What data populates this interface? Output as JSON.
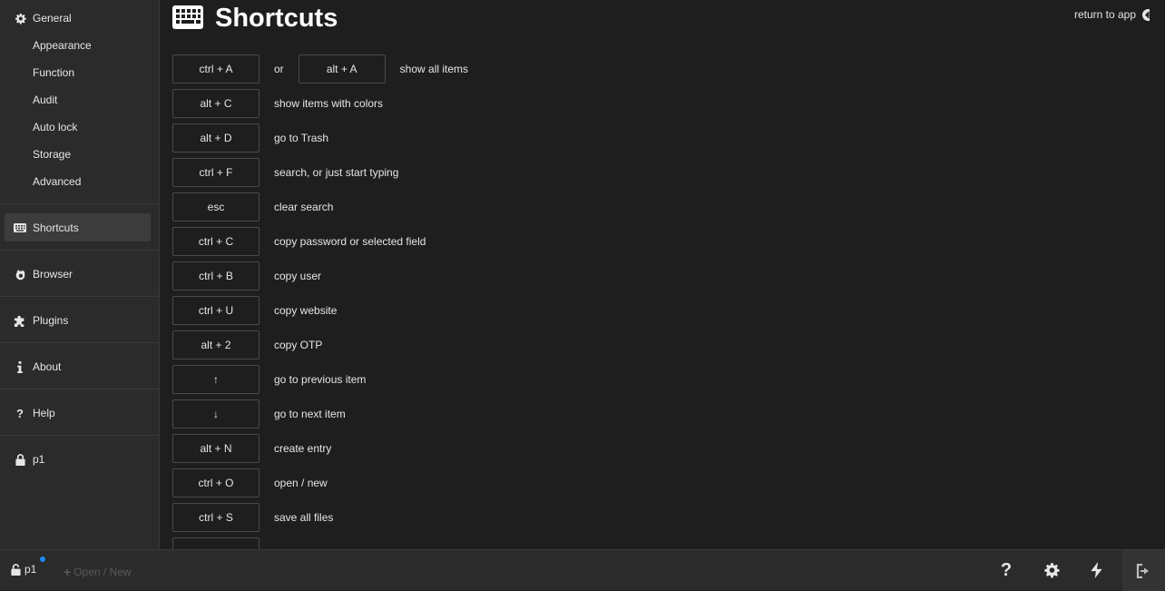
{
  "sidebar": {
    "general": "General",
    "sub_items": [
      "Appearance",
      "Function",
      "Audit",
      "Auto lock",
      "Storage",
      "Advanced"
    ],
    "shortcuts": "Shortcuts",
    "browser": "Browser",
    "plugins": "Plugins",
    "about": "About",
    "help": "Help",
    "file": "p1"
  },
  "header": {
    "title": "Shortcuts",
    "return_label": "return to app"
  },
  "shortcuts": {
    "or_label": "or",
    "rows": [
      {
        "key": "ctrl + A",
        "alt_key": "alt + A",
        "desc": "show all items"
      },
      {
        "key": "alt + C",
        "desc": "show items with colors"
      },
      {
        "key": "alt + D",
        "desc": "go to Trash"
      },
      {
        "key": "ctrl + F",
        "desc": "search, or just start typing"
      },
      {
        "key": "esc",
        "desc": "clear search"
      },
      {
        "key": "ctrl + C",
        "desc": "copy password or selected field"
      },
      {
        "key": "ctrl + B",
        "desc": "copy user"
      },
      {
        "key": "ctrl + U",
        "desc": "copy website"
      },
      {
        "key": "alt + 2",
        "desc": "copy OTP"
      },
      {
        "key": "↑",
        "desc": "go to previous item"
      },
      {
        "key": "↓",
        "desc": "go to next item"
      },
      {
        "key": "alt + N",
        "desc": "create entry"
      },
      {
        "key": "ctrl + O",
        "desc": "open / new"
      },
      {
        "key": "ctrl + S",
        "desc": "save all files"
      },
      {
        "key": "",
        "desc": ""
      }
    ]
  },
  "footer": {
    "file_name": "p1",
    "open_new": "Open / New"
  },
  "colors": {
    "background": "#1e1e1e",
    "sidebar": "#2b2b2b",
    "active_item": "#3c3c3c",
    "unsaved_dot": "#1e88ff"
  },
  "icons": {
    "general": "gear-icon",
    "shortcuts": "keyboard-icon",
    "browser": "firefox-icon",
    "plugins": "puzzle-icon",
    "about": "info-icon",
    "help": "question-icon",
    "file": "lock-icon",
    "return": "arrow-left-circle-icon",
    "footer_help": "question-icon",
    "footer_settings": "gear-icon",
    "footer_generator": "bolt-icon",
    "footer_lock": "sign-out-icon"
  }
}
